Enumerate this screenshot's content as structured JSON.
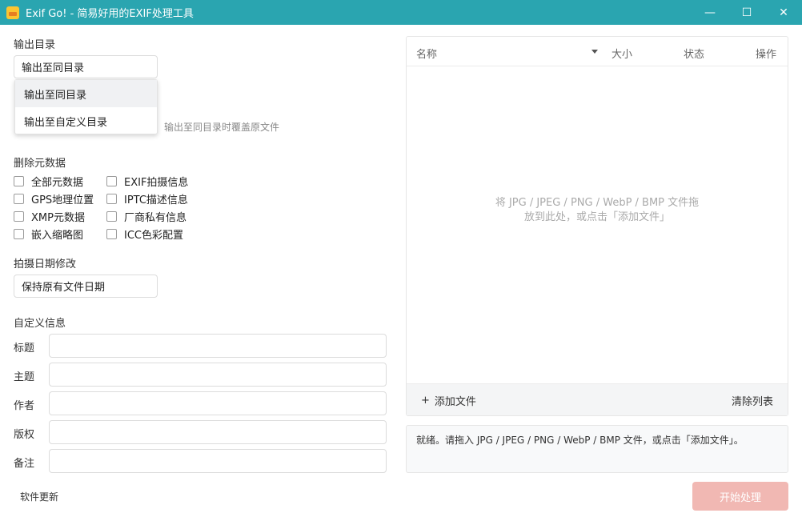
{
  "window": {
    "title": "Exif Go! - 简易好用的EXIF处理工具",
    "minimize": "—",
    "maximize": "☐",
    "close": "✕"
  },
  "output": {
    "label": "输出目录",
    "selected": "输出至同目录",
    "options": [
      "输出至同目录",
      "输出至自定义目录"
    ],
    "hint": "输出至同目录时覆盖原文件"
  },
  "remove_metadata": {
    "label": "删除元数据",
    "options": [
      {
        "label": "全部元数据",
        "checked": false
      },
      {
        "label": "EXIF拍摄信息",
        "checked": false
      },
      {
        "label": "GPS地理位置",
        "checked": false
      },
      {
        "label": "IPTC描述信息",
        "checked": false
      },
      {
        "label": "XMP元数据",
        "checked": false
      },
      {
        "label": "厂商私有信息",
        "checked": false
      },
      {
        "label": "嵌入缩略图",
        "checked": false
      },
      {
        "label": "ICC色彩配置",
        "checked": false
      }
    ]
  },
  "date_modify": {
    "label": "拍摄日期修改",
    "selected": "保持原有文件日期"
  },
  "custom_info": {
    "label": "自定义信息",
    "fields": [
      {
        "label": "标题",
        "value": ""
      },
      {
        "label": "主题",
        "value": ""
      },
      {
        "label": "作者",
        "value": ""
      },
      {
        "label": "版权",
        "value": ""
      },
      {
        "label": "备注",
        "value": ""
      }
    ]
  },
  "update_link": "软件更新",
  "file_table": {
    "columns": [
      "名称",
      "大小",
      "状态",
      "操作"
    ],
    "empty_hint_line1": "将 JPG / JPEG / PNG / WebP / BMP 文件拖",
    "empty_hint_line2": "放到此处，或点击「添加文件」",
    "add_file": "添加文件",
    "clear_list": "清除列表"
  },
  "log": "就绪。请拖入 JPG / JPEG / PNG / WebP / BMP 文件，或点击「添加文件」。",
  "start_button": "开始处理",
  "colors": {
    "titlebar": "#2aa5b0",
    "start_button_disabled": "#f1b8b3"
  }
}
